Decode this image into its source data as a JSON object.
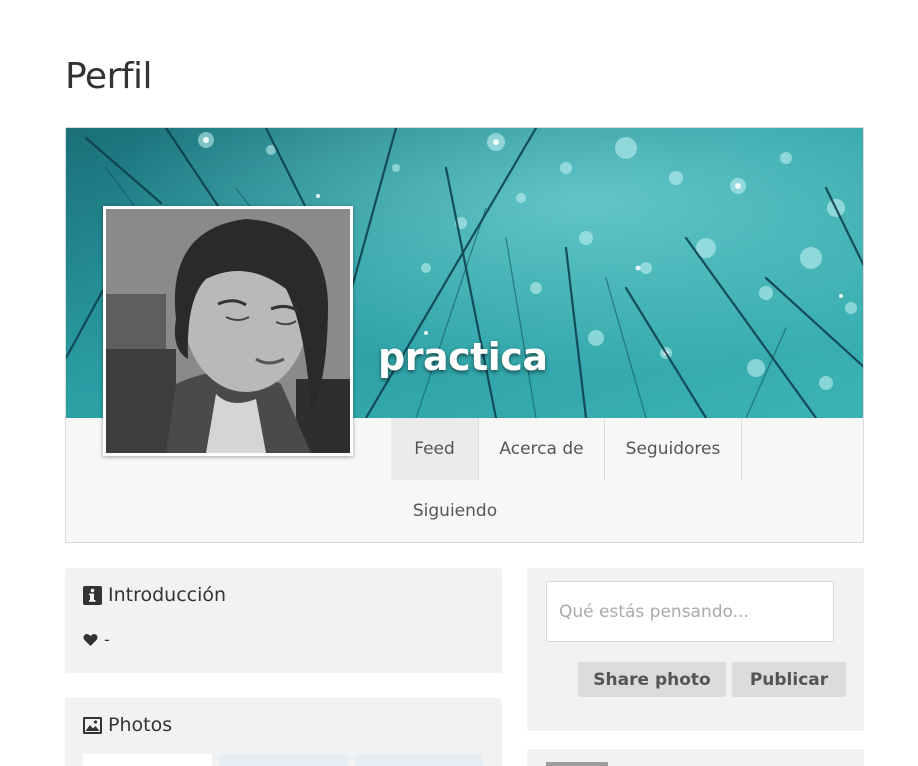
{
  "page": {
    "title": "Perfil"
  },
  "profile": {
    "username": "practica",
    "tabs": [
      {
        "label": "Feed",
        "active": true
      },
      {
        "label": "Acerca de",
        "active": false
      },
      {
        "label": "Seguidores",
        "active": false
      },
      {
        "label": "Siguiendo",
        "active": false
      }
    ]
  },
  "intro": {
    "title": "Introducción",
    "icon": "info-icon",
    "relationship_icon": "heart-icon",
    "relationship_value": "-"
  },
  "photos": {
    "title": "Photos",
    "icon": "image-icon"
  },
  "composer": {
    "placeholder": "Qué estás pensando...",
    "share_label": "Share photo",
    "publish_label": "Publicar"
  },
  "colors": {
    "cover_teal": "#2a9ea3",
    "panel_bg": "#f2f2f2",
    "button_bg": "#dcdcdc",
    "active_tab_bg": "#ebebeb"
  }
}
